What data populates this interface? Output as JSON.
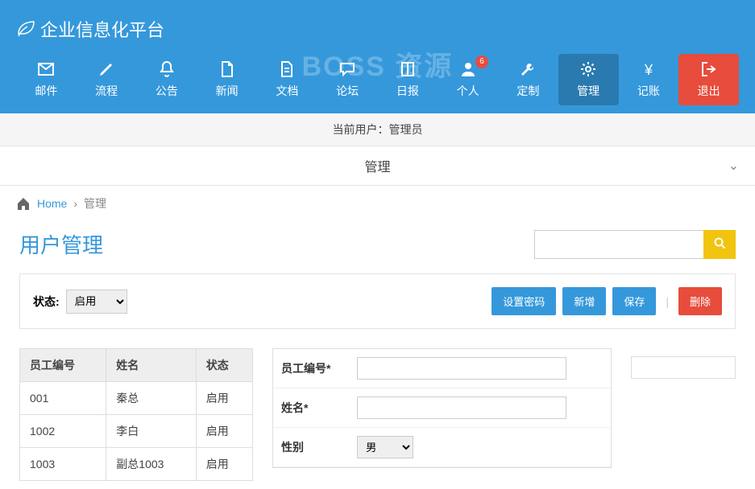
{
  "brand": "企业信息化平台",
  "watermark": "BOSS 资源",
  "nav": [
    {
      "label": "邮件",
      "icon": "mail"
    },
    {
      "label": "流程",
      "icon": "pencil"
    },
    {
      "label": "公告",
      "icon": "bell"
    },
    {
      "label": "新闻",
      "icon": "file"
    },
    {
      "label": "文档",
      "icon": "doc"
    },
    {
      "label": "论坛",
      "icon": "chat"
    },
    {
      "label": "日报",
      "icon": "book"
    },
    {
      "label": "个人",
      "icon": "user",
      "badge": "6"
    },
    {
      "label": "定制",
      "icon": "wrench"
    },
    {
      "label": "管理",
      "icon": "gears",
      "active": true
    },
    {
      "label": "记账",
      "icon": "yen"
    },
    {
      "label": "退出",
      "icon": "exit",
      "danger": true
    }
  ],
  "userbar": {
    "prefix": "当前用户：",
    "name": "管理员"
  },
  "section": "管理",
  "breadcrumb": {
    "home": "Home",
    "current": "管理"
  },
  "page": {
    "title": "用户管理"
  },
  "search": {
    "placeholder": ""
  },
  "toolbar": {
    "status_label": "状态:",
    "status_value": "启用",
    "btn_setpwd": "设置密码",
    "btn_add": "新增",
    "btn_save": "保存",
    "btn_delete": "删除"
  },
  "table": {
    "headers": {
      "id": "员工编号",
      "name": "姓名",
      "status": "状态"
    },
    "rows": [
      {
        "id": "001",
        "name": "秦总",
        "status": "启用"
      },
      {
        "id": "1002",
        "name": "李白",
        "status": "启用"
      },
      {
        "id": "1003",
        "name": "副总1003",
        "status": "启用"
      }
    ]
  },
  "form": {
    "emp_id_label": "员工编号*",
    "emp_id_value": "",
    "name_label": "姓名*",
    "name_value": "",
    "gender_label": "性别",
    "gender_value": "男"
  }
}
